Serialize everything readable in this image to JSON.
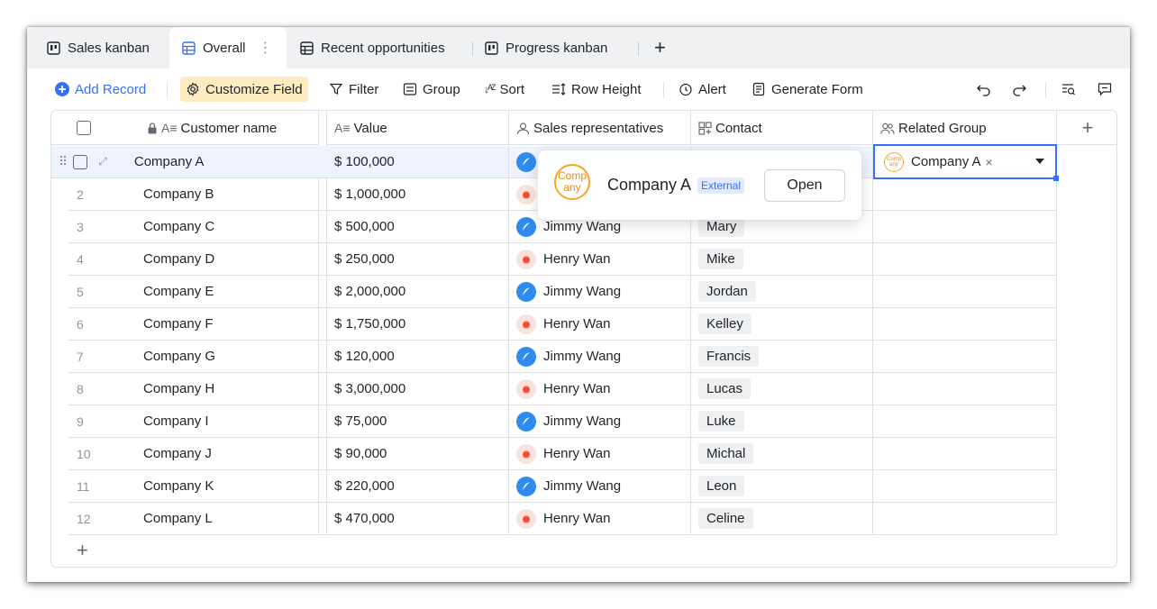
{
  "tabs": [
    {
      "label": "Sales kanban",
      "icon": "kanban-icon"
    },
    {
      "label": "Overall",
      "icon": "grid-icon",
      "active": true
    },
    {
      "label": "Recent opportunities",
      "icon": "grid-icon"
    },
    {
      "label": "Progress kanban",
      "icon": "kanban-icon"
    }
  ],
  "toolbar": {
    "add_record": "Add Record",
    "customize_field": "Customize Field",
    "filter": "Filter",
    "group": "Group",
    "sort": "Sort",
    "row_height": "Row Height",
    "alert": "Alert",
    "generate_form": "Generate Form"
  },
  "columns": {
    "customer_name": "Customer name",
    "value": "Value",
    "sales_reps": "Sales representatives",
    "contact": "Contact",
    "related_group": "Related Group"
  },
  "rows": [
    {
      "num": "",
      "customer": "Company A",
      "value": "$ 100,000",
      "rep": "",
      "contact": ""
    },
    {
      "num": "2",
      "customer": "Company B",
      "value": "$ 1,000,000",
      "rep": "",
      "contact": ""
    },
    {
      "num": "3",
      "customer": "Company C",
      "value": "$ 500,000",
      "rep": "Jimmy Wang",
      "contact": "Mary"
    },
    {
      "num": "4",
      "customer": "Company D",
      "value": "$ 250,000",
      "rep": "Henry Wan",
      "contact": "Mike"
    },
    {
      "num": "5",
      "customer": "Company E",
      "value": "$ 2,000,000",
      "rep": "Jimmy Wang",
      "contact": "Jordan"
    },
    {
      "num": "6",
      "customer": "Company F",
      "value": "$ 1,750,000",
      "rep": "Henry Wan",
      "contact": "Kelley"
    },
    {
      "num": "7",
      "customer": "Company G",
      "value": "$ 120,000",
      "rep": "Jimmy Wang",
      "contact": "Francis"
    },
    {
      "num": "8",
      "customer": "Company H",
      "value": "$ 3,000,000",
      "rep": "Henry Wan",
      "contact": "Lucas"
    },
    {
      "num": "9",
      "customer": "Company I",
      "value": "$ 75,000",
      "rep": "Jimmy Wang",
      "contact": "Luke"
    },
    {
      "num": "10",
      "customer": "Company J",
      "value": "$ 90,000",
      "rep": "Henry Wan",
      "contact": "Michal"
    },
    {
      "num": "11",
      "customer": "Company K",
      "value": "$ 220,000",
      "rep": "Jimmy Wang",
      "contact": "Leon"
    },
    {
      "num": "12",
      "customer": "Company L",
      "value": "$ 470,000",
      "rep": "Henry Wan",
      "contact": "Celine"
    }
  ],
  "popup": {
    "logo_line1": "Comp",
    "logo_line2": "any",
    "name": "Company A",
    "badge": "External",
    "open": "Open"
  },
  "related_cell": {
    "logo_line1": "Comp",
    "logo_line2": "any",
    "value": "Company A",
    "remove": "×"
  },
  "colors": {
    "accent": "#3370ff",
    "highlight": "#fcecc0",
    "selected_row": "#eef3fe",
    "company_logo": "#f5a623"
  }
}
